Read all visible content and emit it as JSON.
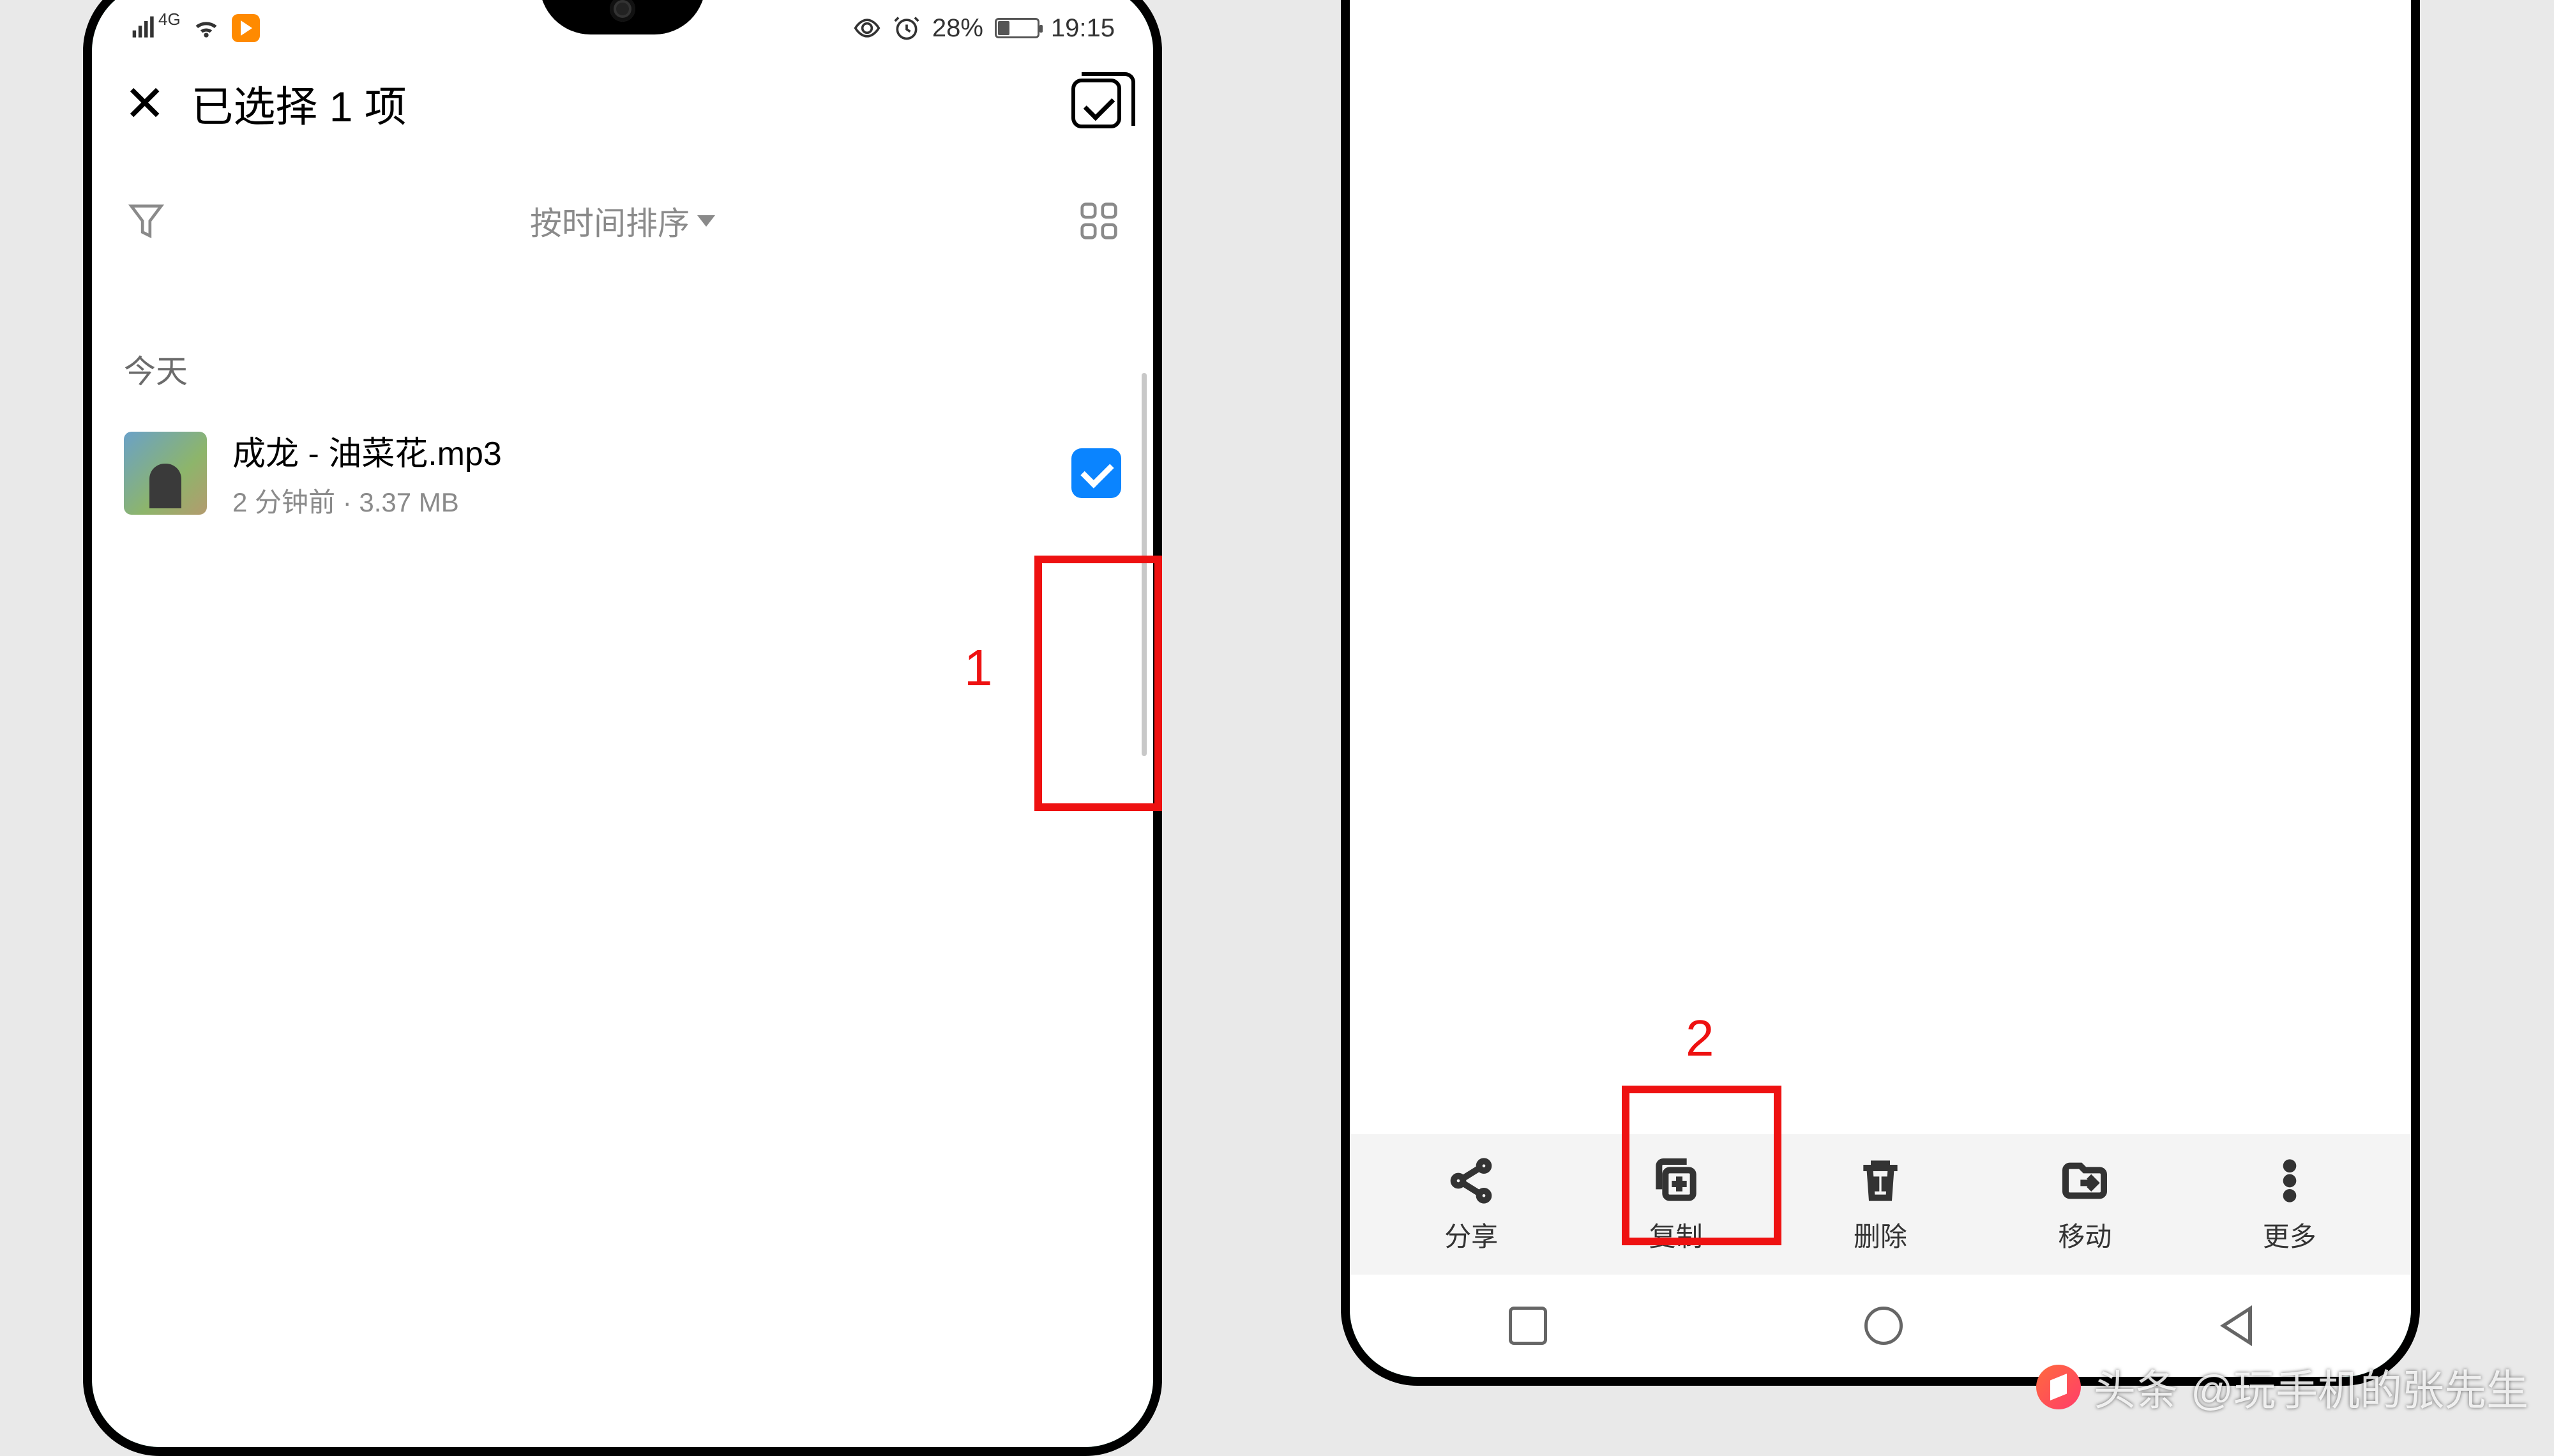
{
  "statusbar": {
    "network": "4G",
    "battery_percent": "28%",
    "time": "19:15"
  },
  "header": {
    "title": "已选择 1 项"
  },
  "sort": {
    "label": "按时间排序"
  },
  "section": {
    "today": "今天"
  },
  "file": {
    "name": "成龙 - 油菜花.mp3",
    "meta": "2 分钟前 · 3.37 MB"
  },
  "annotations": {
    "step1": "1",
    "step2": "2"
  },
  "toolbar": {
    "share": "分享",
    "copy": "复制",
    "delete": "删除",
    "move": "移动",
    "more": "更多"
  },
  "watermark": {
    "prefix": "头条",
    "handle": "@玩手机的张先生"
  }
}
